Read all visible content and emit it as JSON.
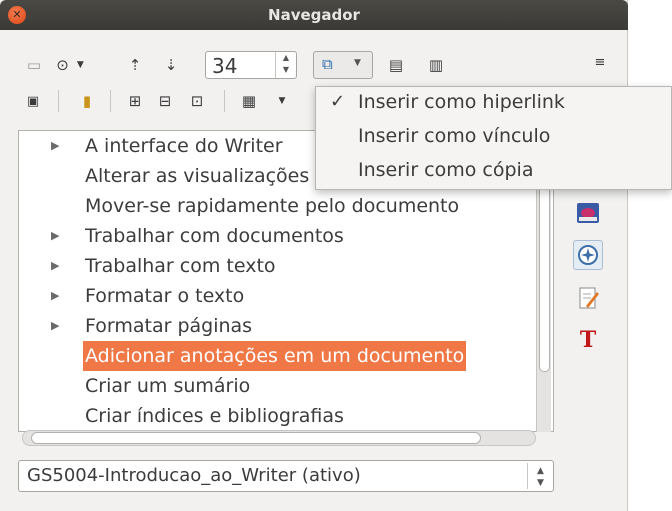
{
  "window": {
    "title": "Navegador"
  },
  "toolbar": {
    "spin_value": "34"
  },
  "menu": {
    "items": [
      "Inserir como hiperlink",
      "Inserir como vínculo",
      "Inserir como cópia"
    ],
    "checked_index": 0
  },
  "tree": {
    "rows": [
      {
        "label": "A interface do Writer",
        "expandable": true
      },
      {
        "label": "Alterar as visualizações",
        "expandable": false
      },
      {
        "label": "Mover-se rapidamente pelo documento",
        "expandable": false
      },
      {
        "label": "Trabalhar com documentos",
        "expandable": true
      },
      {
        "label": "Trabalhar com texto",
        "expandable": true
      },
      {
        "label": "Formatar o texto",
        "expandable": true
      },
      {
        "label": "Formatar páginas",
        "expandable": true
      },
      {
        "label": "Adicionar anotações em um documento",
        "expandable": false,
        "selected": true
      },
      {
        "label": "Criar um sumário",
        "expandable": false
      },
      {
        "label": "Criar índices e bibliografias",
        "expandable": false
      }
    ]
  },
  "document_select": {
    "value": "GS5004-Introducao_ao_Writer (ativo)"
  },
  "icons": {
    "close": "close-icon",
    "navigation_toggle": "navigation-toggle-icon",
    "navigate_by": "navigate-by-icon",
    "previous": "previous-icon",
    "next": "next-icon",
    "drag_mode": "drag-mode-icon",
    "promote": "promote-level-icon",
    "demote": "demote-level-icon",
    "sidebar_menu": "sidebar-menu-icon",
    "gallery": "gallery-icon",
    "navigator": "navigator-icon",
    "manage_changes": "manage-changes-icon",
    "styles": "styles-icon"
  },
  "colors": {
    "selection": "#f07746",
    "titlebar": "#3b3a36",
    "close": "#dd4814"
  }
}
